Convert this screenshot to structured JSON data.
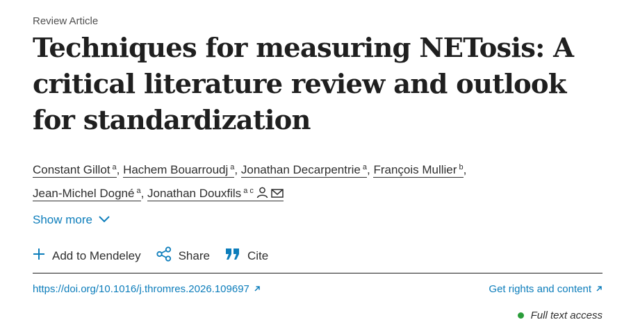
{
  "article_type": "Review Article",
  "title": "Techniques for measuring NETosis: A critical literature review and outlook for standardization",
  "authors": [
    {
      "name": "Constant Gillot",
      "sup": "a"
    },
    {
      "name": "Hachem Bouarroudj",
      "sup": "a"
    },
    {
      "name": "Jonathan Decarpentrie",
      "sup": "a"
    },
    {
      "name": "François Mullier",
      "sup": "b"
    },
    {
      "name": "Jean-Michel Dogné",
      "sup": "a"
    },
    {
      "name": "Jonathan Douxfils",
      "sup": "a c"
    }
  ],
  "show_more": "Show more",
  "actions": {
    "mendeley": "Add to Mendeley",
    "share": "Share",
    "cite": "Cite"
  },
  "doi": "https://doi.org/10.1016/j.thromres.2026.109697",
  "rights": "Get rights and content",
  "access": "Full text access",
  "colors": {
    "link": "#0c7dbb",
    "access_dot": "#2a9d3a"
  }
}
